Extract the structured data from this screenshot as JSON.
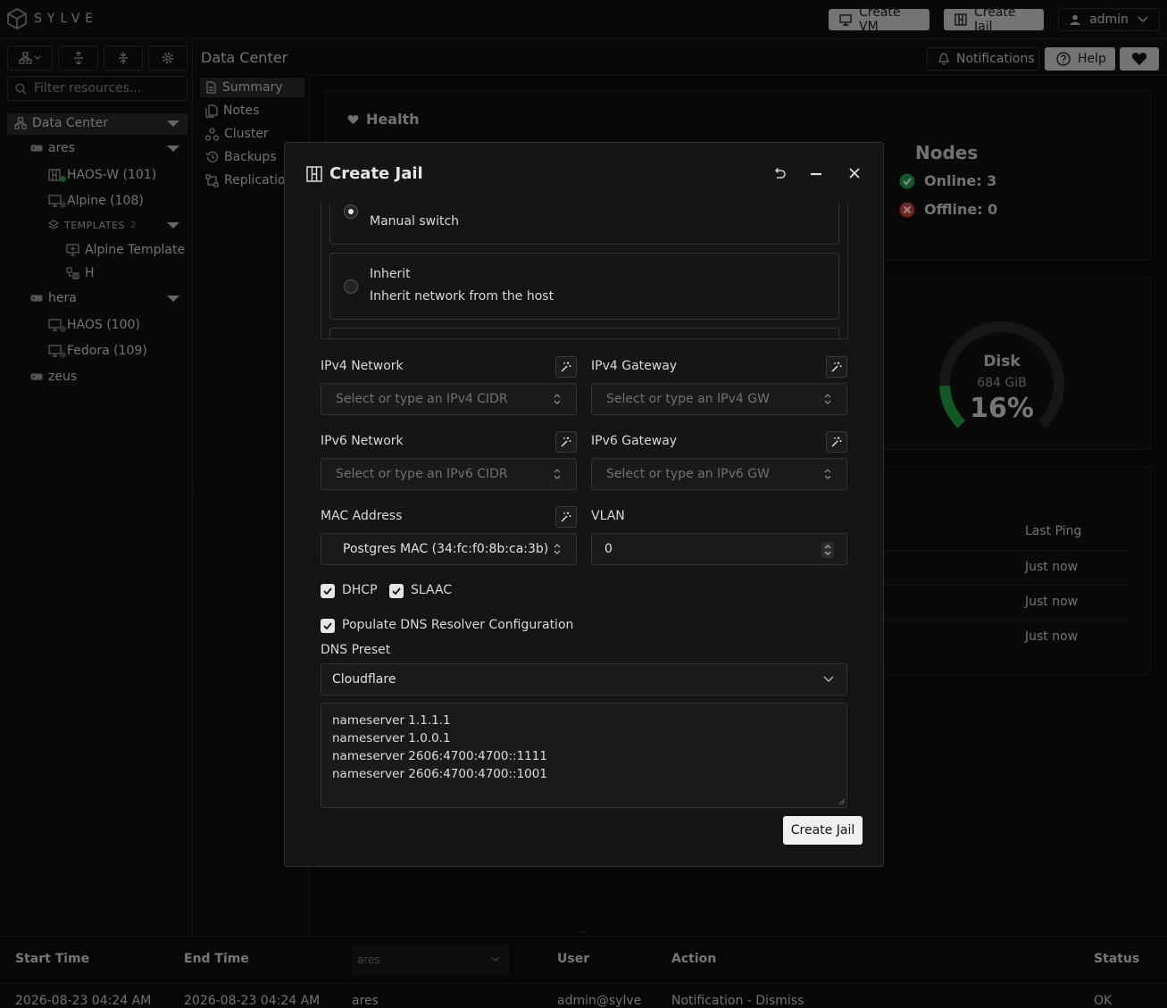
{
  "app": {
    "logo_text": "SYLVE"
  },
  "topbar": {
    "create_vm": "Create VM",
    "create_jail": "Create Jail",
    "user": "admin"
  },
  "left": {
    "filter_placeholder": "Filter resources...",
    "tree": {
      "datacenter": "Data Center",
      "ares": "ares",
      "haos_w": "HAOS-W (101)",
      "alpine": "Alpine (108)",
      "templates": "TEMPLATES",
      "templates_count": "2",
      "alpine_template": "Alpine Template",
      "h": "H",
      "hera": "hera",
      "haos": "HAOS (100)",
      "fedora": "Fedora (109)",
      "zeus": "zeus"
    },
    "status_colors": {
      "running": "#22a045",
      "stopped": "#555555"
    }
  },
  "header": {
    "breadcrumb": "Data Center",
    "notifications": "Notifications",
    "help": "Help"
  },
  "nav": {
    "summary": "Summary",
    "notes": "Notes",
    "cluster": "Cluster",
    "backups": "Backups",
    "replication": "Replication"
  },
  "summary": {
    "health_title": "Health",
    "nodes_title": "Nodes",
    "online": "Online: 3",
    "offline": "Offline: 0",
    "disk_label": "Disk",
    "disk_size": "684 GiB",
    "disk_pct": "16%",
    "disk_fraction": 0.16,
    "last_ping_header": "Last Ping",
    "pings": [
      "Just now",
      "Just now",
      "Just now"
    ]
  },
  "bottom": {
    "headers": {
      "start": "Start Time",
      "end": "End Time",
      "node_filter": "ares",
      "user": "User",
      "action": "Action",
      "status": "Status"
    },
    "row": {
      "start": "2026-08-23 04:24 AM",
      "end": "2026-08-23 04:24 AM",
      "node": "ares",
      "user": "admin@sylve",
      "action": "Notification - Dismiss",
      "status": "OK"
    }
  },
  "modal": {
    "title": "Create Jail",
    "switch_manual": "Manual switch",
    "inherit_title": "Inherit",
    "inherit_desc": "Inherit network from the host",
    "ipv4_network_label": "IPv4 Network",
    "ipv4_network_placeholder": "Select or type an IPv4 CIDR",
    "ipv4_gateway_label": "IPv4 Gateway",
    "ipv4_gateway_placeholder": "Select or type an IPv4 GW",
    "ipv6_network_label": "IPv6 Network",
    "ipv6_network_placeholder": "Select or type an IPv6 CIDR",
    "ipv6_gateway_label": "IPv6 Gateway",
    "ipv6_gateway_placeholder": "Select or type an IPv6 GW",
    "mac_label": "MAC Address",
    "mac_value": "Postgres MAC (34:fc:f0:8b:ca:3b)",
    "vlan_label": "VLAN",
    "vlan_value": "0",
    "dhcp": "DHCP",
    "slaac": "SLAAC",
    "populate_dns": "Populate DNS Resolver Configuration",
    "dns_preset_label": "DNS Preset",
    "dns_preset_value": "Cloudflare",
    "dns_config": "nameserver 1.1.1.1\nnameserver 1.0.0.1\nnameserver 2606:4700:4700::1111\nnameserver 2606:4700:4700::1001",
    "submit": "Create Jail"
  }
}
